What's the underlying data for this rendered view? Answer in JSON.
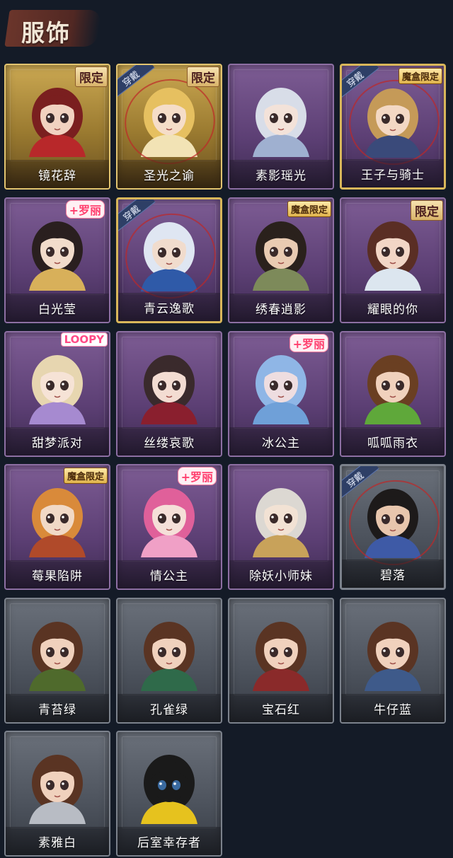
{
  "header": {
    "title": "服饰"
  },
  "badges": {
    "limited": "限定",
    "box_limited": "魔盒限定",
    "wearing": "穿戴",
    "loli": "+罗丽",
    "loopy": "LOOPY"
  },
  "costumes": [
    {
      "name": "镜花辞",
      "tier": "gold",
      "badge": "limited",
      "wearing": false,
      "hair": "#7a1f1f",
      "skin": "#f1d2c0",
      "accent": "#b8282a"
    },
    {
      "name": "圣光之谕",
      "tier": "gold",
      "badge": "limited",
      "wearing": true,
      "hair": "#e6c060",
      "skin": "#f5ddc8",
      "accent": "#f2e3b5"
    },
    {
      "name": "素影瑶光",
      "tier": "purple",
      "badge": "",
      "wearing": false,
      "hair": "#d8dde8",
      "skin": "#f3e2d9",
      "accent": "#9fb0d0"
    },
    {
      "name": "王子与骑士",
      "tier": "purple-gold",
      "badge": "box_limited",
      "wearing": true,
      "hair": "#c59a58",
      "skin": "#f3d8c4",
      "accent": "#3a4a7a"
    },
    {
      "name": "白光莹",
      "tier": "purple",
      "badge": "loli",
      "wearing": false,
      "hair": "#2a1f1f",
      "skin": "#f2dccb",
      "accent": "#d8b05a"
    },
    {
      "name": "青云逸歌",
      "tier": "purple-gold",
      "badge": "",
      "wearing": true,
      "hair": "#dfe6f2",
      "skin": "#f1dccd",
      "accent": "#2f5aa8"
    },
    {
      "name": "绣春逍影",
      "tier": "purple",
      "badge": "box_limited",
      "wearing": false,
      "hair": "#2a211c",
      "skin": "#e9cbb2",
      "accent": "#7d8a5a"
    },
    {
      "name": "耀眼的你",
      "tier": "purple",
      "badge": "limited",
      "wearing": false,
      "hair": "#5a2e24",
      "skin": "#f2d6c6",
      "accent": "#dce6ef"
    },
    {
      "name": "甜梦派对",
      "tier": "purple",
      "badge": "loopy",
      "wearing": false,
      "hair": "#e7d6b0",
      "skin": "#f6e3d6",
      "accent": "#a68ad0"
    },
    {
      "name": "丝缕哀歌",
      "tier": "purple",
      "badge": "",
      "wearing": false,
      "hair": "#3a2a2c",
      "skin": "#f3dcd2",
      "accent": "#8a1f2e"
    },
    {
      "name": "冰公主",
      "tier": "purple",
      "badge": "loli",
      "wearing": false,
      "hair": "#8fb6e6",
      "skin": "#eedde0",
      "accent": "#6fa0d8"
    },
    {
      "name": "呱呱雨衣",
      "tier": "purple",
      "badge": "",
      "wearing": false,
      "hair": "#6a3f22",
      "skin": "#f0d1bc",
      "accent": "#5fa83a"
    },
    {
      "name": "莓果陷阱",
      "tier": "purple",
      "badge": "box_limited",
      "wearing": false,
      "hair": "#d98a3a",
      "skin": "#f1d9c6",
      "accent": "#b04a2a"
    },
    {
      "name": "情公主",
      "tier": "purple",
      "badge": "loli",
      "wearing": false,
      "hair": "#e0609a",
      "skin": "#f5dfd8",
      "accent": "#f0a0c6"
    },
    {
      "name": "除妖小师妹",
      "tier": "purple",
      "badge": "",
      "wearing": false,
      "hair": "#dcd8d2",
      "skin": "#f2e2d4",
      "accent": "#c8a25a"
    },
    {
      "name": "碧落",
      "tier": "gray-gold",
      "badge": "",
      "wearing": true,
      "hair": "#1d1a1a",
      "skin": "#e8c6ad",
      "accent": "#3e5aa6"
    },
    {
      "name": "青苔绿",
      "tier": "gray",
      "badge": "",
      "wearing": false,
      "hair": "#5a3423",
      "skin": "#f0d1bd",
      "accent": "#4f6a2c"
    },
    {
      "name": "孔雀绿",
      "tier": "gray",
      "badge": "",
      "wearing": false,
      "hair": "#5a3423",
      "skin": "#f0d1bd",
      "accent": "#2f6a4a"
    },
    {
      "name": "宝石红",
      "tier": "gray",
      "badge": "",
      "wearing": false,
      "hair": "#5a3423",
      "skin": "#f0d1bd",
      "accent": "#8a2a2a"
    },
    {
      "name": "牛仔蓝",
      "tier": "gray",
      "badge": "",
      "wearing": false,
      "hair": "#5a3423",
      "skin": "#f0d1bd",
      "accent": "#3e5a8a"
    },
    {
      "name": "素雅白",
      "tier": "gray",
      "badge": "",
      "wearing": false,
      "hair": "#5a3423",
      "skin": "#f0d1bd",
      "accent": "#b8bcc4"
    },
    {
      "name": "后室幸存者",
      "tier": "gray",
      "badge": "",
      "wearing": false,
      "hair": "#1a1a1a",
      "skin": "#1a1a1a",
      "accent": "#e6c21e"
    }
  ]
}
